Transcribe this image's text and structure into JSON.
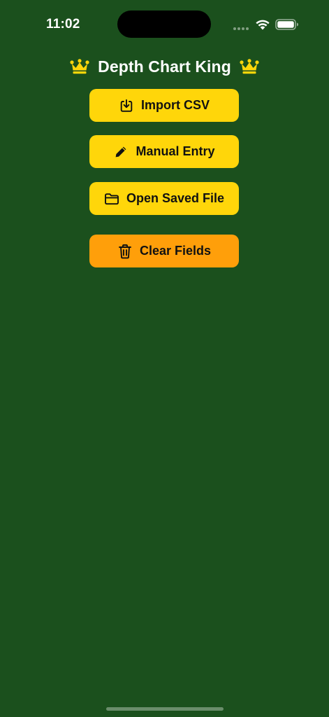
{
  "status_bar": {
    "time": "11:02"
  },
  "header": {
    "title": "Depth Chart King",
    "left_icon": "crown-icon",
    "right_icon": "crown-icon"
  },
  "buttons": [
    {
      "label": "Import CSV",
      "icon": "import-icon",
      "color": "#ffd60a"
    },
    {
      "label": "Manual Entry",
      "icon": "pencil-icon",
      "color": "#ffd60a"
    },
    {
      "label": "Open Saved File",
      "icon": "folder-icon",
      "color": "#ffd60a"
    },
    {
      "label": "Clear Fields",
      "icon": "trash-icon",
      "color": "#ff9f0a"
    }
  ],
  "colors": {
    "background": "#1b501d",
    "accent_yellow": "#ffd60a",
    "accent_orange": "#ff9f0a"
  }
}
